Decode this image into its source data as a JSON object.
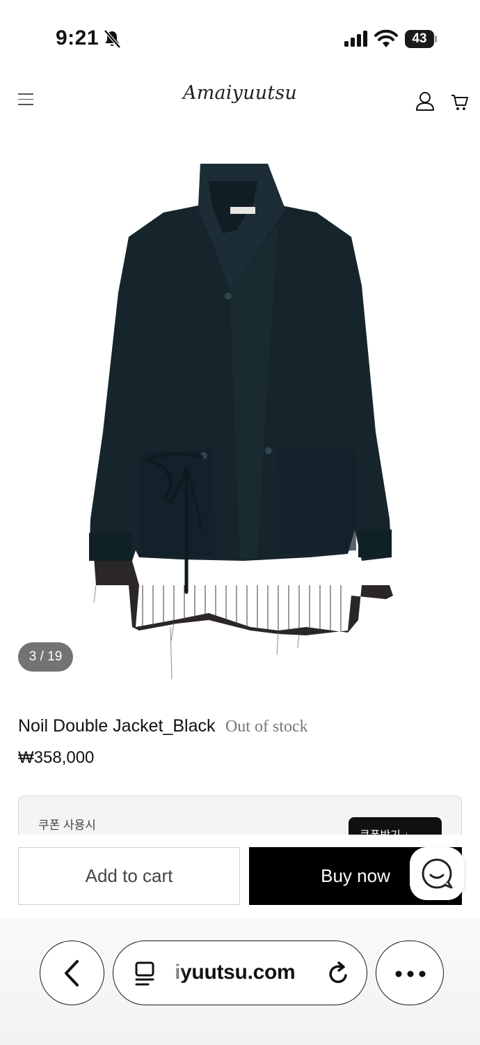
{
  "status_bar": {
    "time": "9:21",
    "battery": "43"
  },
  "header": {
    "logo": "Amaiyuutsu"
  },
  "gallery": {
    "counter": "3 / 19"
  },
  "product": {
    "name": "Noil Double Jacket_Black",
    "stock_status": "Out of stock",
    "price": "₩358,000"
  },
  "coupon": {
    "label": "쿠폰 사용시",
    "button_label": "쿠폰받기 ↓"
  },
  "actions": {
    "add_to_cart": "Add to cart",
    "buy_now": "Buy now"
  },
  "browser": {
    "url": "iyuutsu.com"
  },
  "colors": {
    "jacket": "#16252c",
    "lining": "#2b2628",
    "buy_button": "#000000"
  }
}
